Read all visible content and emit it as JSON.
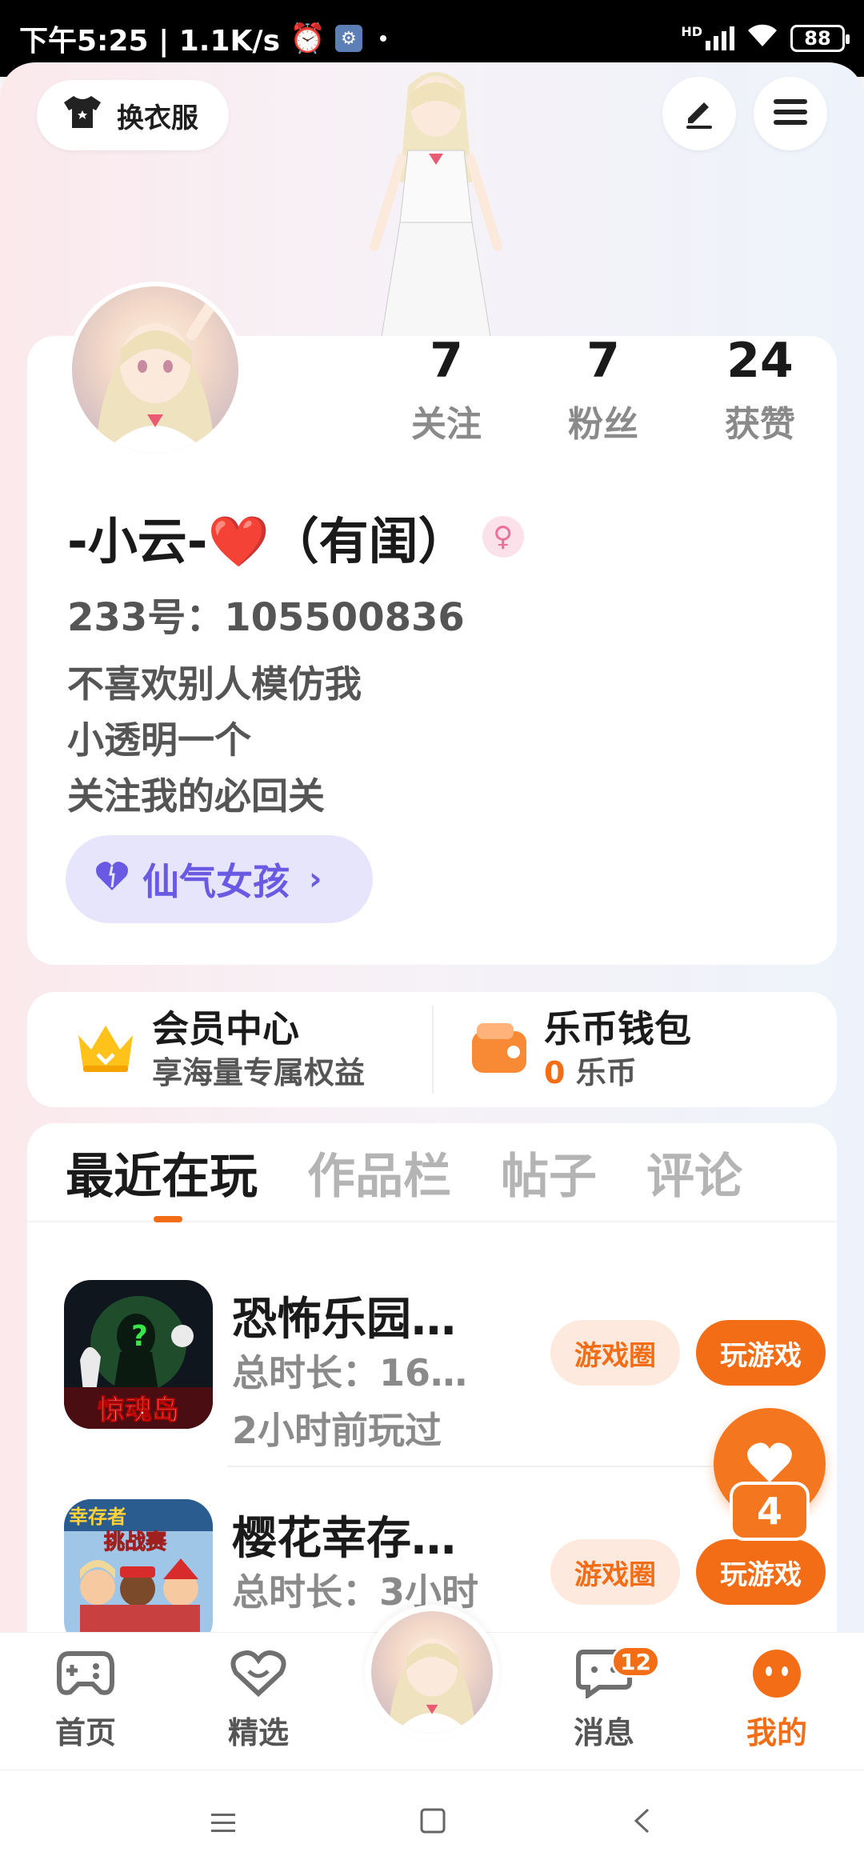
{
  "status_bar": {
    "time_text": "下午5:25 | 1.1K/s",
    "network": "HD",
    "battery": "88"
  },
  "header": {
    "wardrobe_label": "换衣服"
  },
  "profile": {
    "stats": [
      {
        "value": "7",
        "label": "关注"
      },
      {
        "value": "7",
        "label": "粉丝"
      },
      {
        "value": "24",
        "label": "获赞"
      }
    ],
    "nickname": "-小云-❤️（有闺）",
    "id_text": "233号：105500836",
    "bio_lines": [
      "不喜欢别人模仿我",
      "小透明一个",
      "关注我的必回关"
    ],
    "tag_label": "仙气女孩",
    "tag_chevron": "›"
  },
  "wallet": {
    "vip_title": "会员中心",
    "vip_sub": "享海量专属权益",
    "coin_title": "乐币钱包",
    "coin_amount": "0",
    "coin_unit": "乐币"
  },
  "tabs": [
    "最近在玩",
    "作品栏",
    "帖子",
    "评论"
  ],
  "games": [
    {
      "title": "恐怖乐园…",
      "duration": "总时长：16…",
      "last_played": "2小时前玩过",
      "circle_label": "游戏圈",
      "play_label": "玩游戏"
    },
    {
      "title": "樱花幸存…",
      "duration": "总时长：3小时",
      "last_played": "",
      "circle_label": "游戏圈",
      "play_label": "玩游戏"
    }
  ],
  "game_icon_texts": [
    "惊魂岛",
    "幸存者",
    "挑战赛"
  ],
  "floating": {
    "count": "4"
  },
  "bottom_nav": {
    "items": [
      {
        "label": "首页"
      },
      {
        "label": "精选"
      },
      {
        "label": "消息",
        "badge": "12"
      },
      {
        "label": "我的"
      }
    ]
  },
  "colors": {
    "accent": "#f36d17",
    "tag_purple": "#6a59e3"
  }
}
